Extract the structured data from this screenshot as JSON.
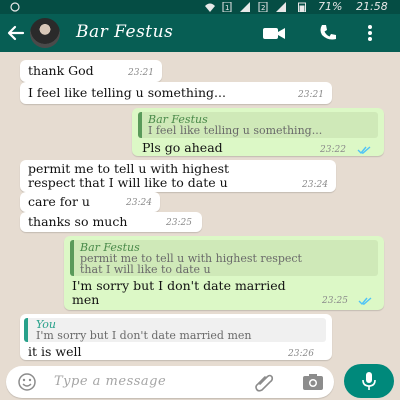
{
  "status": {
    "battery_percent": "71%",
    "time": "21:58"
  },
  "header": {
    "contact_name": "Bar Festus"
  },
  "messages": {
    "m1": {
      "text": "thank God",
      "time": "23:21"
    },
    "m2": {
      "text": "I feel like telling u something...",
      "time": "23:21"
    },
    "m3": {
      "quote_author": "Bar Festus",
      "quote_text": "I feel like telling u something...",
      "text": "Pls go ahead",
      "time": "23:22"
    },
    "m4": {
      "line1": "permit me to tell u with highest",
      "line2": "respect that I will like to date u",
      "time": "23:24"
    },
    "m5": {
      "text": "care for u",
      "time": "23:24"
    },
    "m6": {
      "text": "thanks so much",
      "time": "23:25"
    },
    "m7": {
      "quote_author": "Bar Festus",
      "quote_line1": "permit me to tell u with highest respect",
      "quote_line2": "that I will like to date u",
      "line1": "I'm sorry but I don't date married",
      "line2": "men",
      "time": "23:25"
    },
    "m8": {
      "quote_author": "You",
      "quote_text": "I'm sorry but I don't date married men",
      "text": "it is well",
      "time": "23:26"
    }
  },
  "composer": {
    "placeholder": "Type a message"
  },
  "colors": {
    "header": "#075e54",
    "status_bar": "#054d44",
    "outgoing_bubble": "#dcf8c6",
    "incoming_bubble": "#ffffff",
    "read_ticks": "#4fc3f7",
    "mic_button": "#00897b"
  },
  "icons": [
    "back-arrow-icon",
    "video-call-icon",
    "phone-icon",
    "more-options-icon",
    "emoji-icon",
    "attach-icon",
    "camera-icon",
    "mic-icon",
    "double-check-icon"
  ]
}
